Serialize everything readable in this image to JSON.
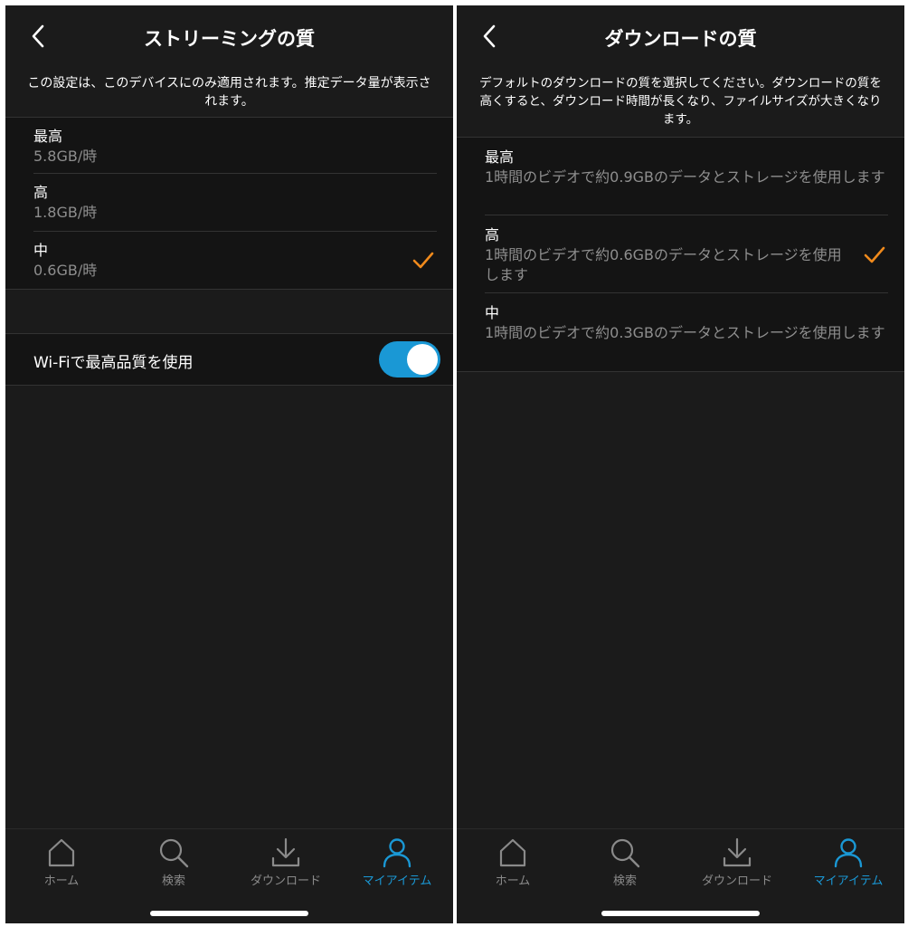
{
  "left": {
    "title": "ストリーミングの質",
    "description": "この設定は、このデバイスにのみ適用されます。推定データ量が表示されます。",
    "options": [
      {
        "title": "最高",
        "sub": "5.8GB/時",
        "selected": false
      },
      {
        "title": "高",
        "sub": "1.8GB/時",
        "selected": false
      },
      {
        "title": "中",
        "sub": "0.6GB/時",
        "selected": true
      }
    ],
    "wifi_toggle": {
      "label": "Wi-Fiで最高品質を使用",
      "on": true
    }
  },
  "right": {
    "title": "ダウンロードの質",
    "description": "デフォルトのダウンロードの質を選択してください。ダウンロードの質を高くすると、ダウンロード時間が長くなり、ファイルサイズが大きくなります。",
    "options": [
      {
        "title": "最高",
        "sub": "1時間のビデオで約0.9GBのデータとストレージを使用します",
        "selected": false
      },
      {
        "title": "高",
        "sub": "1時間のビデオで約0.6GBのデータとストレージを使用します",
        "selected": true
      },
      {
        "title": "中",
        "sub": "1時間のビデオで約0.3GBのデータとストレージを使用します",
        "selected": false
      }
    ]
  },
  "tabbar": {
    "tabs": [
      {
        "label": "ホーム",
        "icon": "home-icon",
        "active": false
      },
      {
        "label": "検索",
        "icon": "search-icon",
        "active": false
      },
      {
        "label": "ダウンロード",
        "icon": "download-icon",
        "active": false
      },
      {
        "label": "マイアイテム",
        "icon": "person-icon",
        "active": true
      }
    ]
  },
  "colors": {
    "background": "#1b1b1b",
    "list_background": "#141414",
    "accent_blue": "#1a98d5",
    "check_orange": "#f08a1c",
    "secondary_text": "#8e8e8e"
  }
}
